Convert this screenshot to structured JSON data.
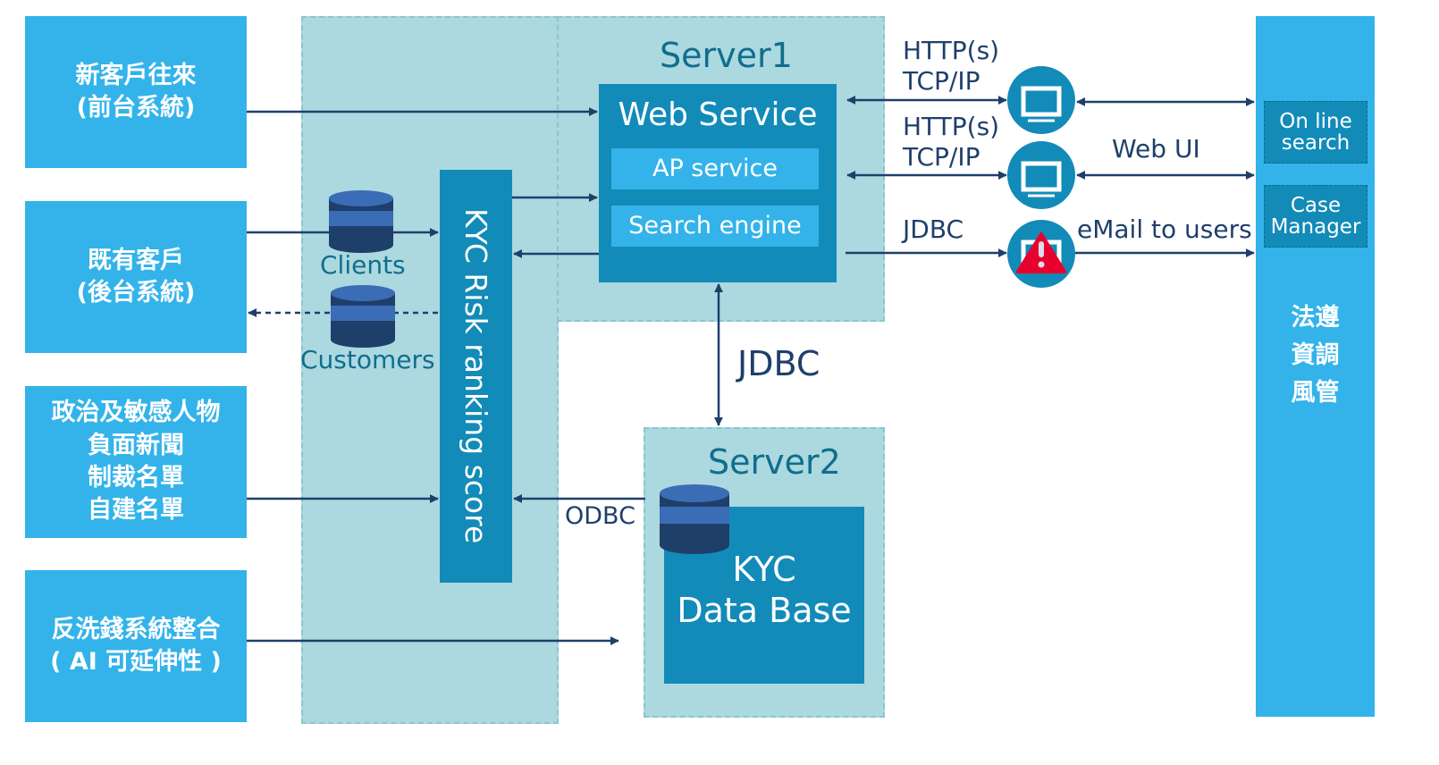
{
  "sources": [
    {
      "lines": [
        "新客戶往來",
        "(前台系統)"
      ]
    },
    {
      "lines": [
        "既有客戶",
        "(後台系統)"
      ]
    },
    {
      "lines": [
        "政治及敏感人物",
        "負面新聞",
        "制裁名單",
        "自建名單"
      ]
    },
    {
      "lines": [
        "反洗錢系統整合",
        "( AI 可延伸性 )"
      ]
    }
  ],
  "server1": {
    "title": "Server1",
    "web_service": "Web Service",
    "ap_service": "AP service",
    "search_engine": "Search engine"
  },
  "server2": {
    "title": "Server2",
    "db_lines": [
      "KYC",
      "Data Base"
    ]
  },
  "kyc_score": "KYC Risk ranking score",
  "databases": {
    "clients": "Clients",
    "customers": "Customers"
  },
  "connections": {
    "http1": [
      "HTTP(s)",
      "TCP/IP"
    ],
    "http2": [
      "HTTP(s)",
      "TCP/IP"
    ],
    "jdbc_small": "JDBC",
    "jdbc_big": "JDBC",
    "odbc": "ODBC",
    "web_ui": "Web UI",
    "email": "eMail to users"
  },
  "right_panel": {
    "online_search": [
      "On line",
      "search"
    ],
    "case_manager": [
      "Case",
      "Manager"
    ],
    "lines": [
      "法遵",
      "資調",
      "風管"
    ]
  },
  "colors": {
    "source_blue": "#33b3ea",
    "dark_blue": "#128bb8",
    "zone": "#acd8e0",
    "arrow": "#1f3f6b",
    "alert": "#e8002f"
  }
}
